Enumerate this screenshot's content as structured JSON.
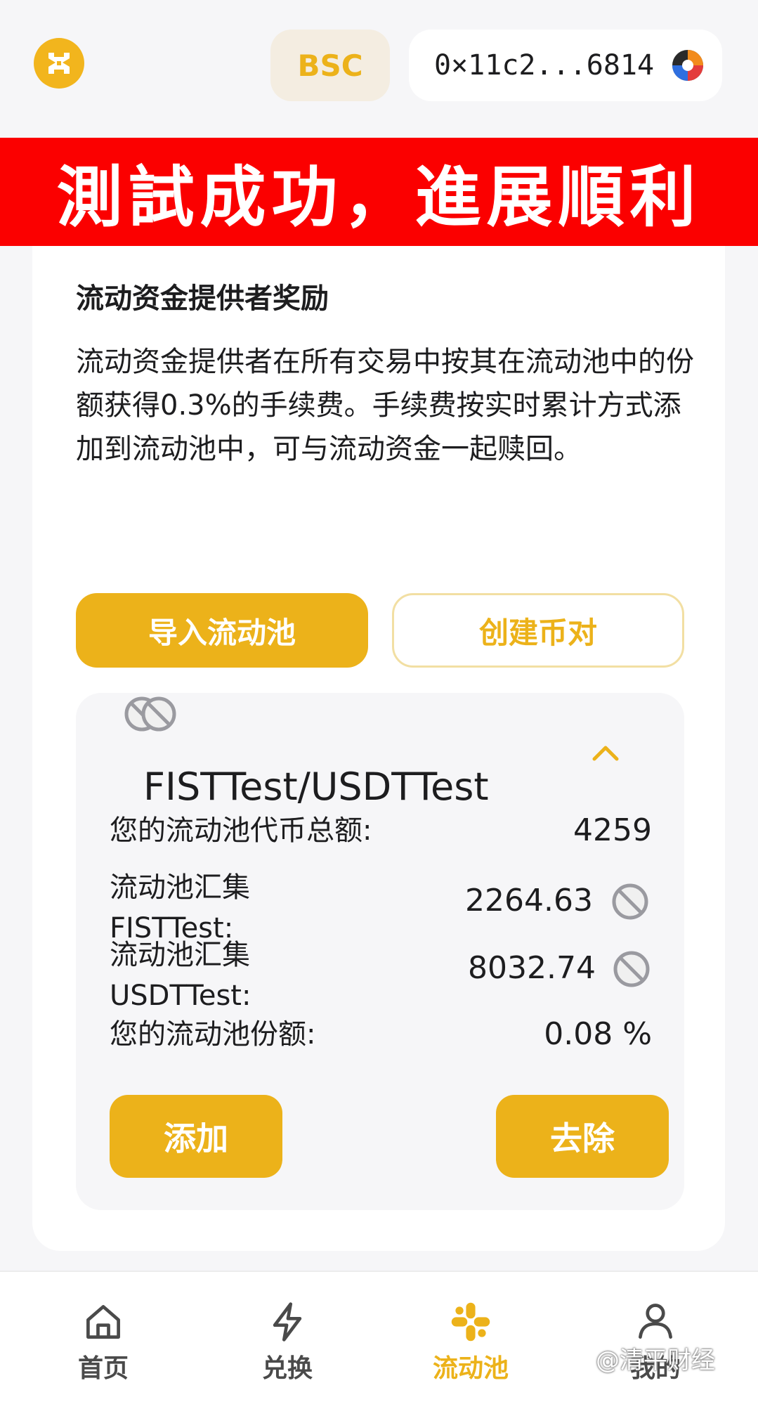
{
  "header": {
    "logo_icon": "app-logo-icon",
    "chain": "BSC",
    "wallet_address": "0×11c2...6814",
    "wallet_avatar_icon": "wallet-avatar-icon"
  },
  "banner": {
    "text": "測試成功，進展順利",
    "background": "#fb0000"
  },
  "info": {
    "title": "流动资金提供者奖励",
    "description": "流动资金提供者在所有交易中按其在流动池中的份额获得0.3%的手续费。手续费按实时累计方式添加到流动池中，可与流动资金一起赎回。"
  },
  "actions": {
    "import_label": "导入流动池",
    "create_label": "创建币对"
  },
  "pool": {
    "pair_name": "FISTTest/USDTTest",
    "rows": [
      {
        "label": "您的流动池代币总额:",
        "value": "4259"
      },
      {
        "label": "流动池汇集\nFISTTest:",
        "value": "2264.63"
      },
      {
        "label": "流动池汇集\nUSDTTest:",
        "value": "8032.74"
      },
      {
        "label": "您的流动池份额:",
        "value": "0.08 %"
      }
    ],
    "add_label": "添加",
    "remove_label": "去除"
  },
  "nav": {
    "items": [
      {
        "label": "首页",
        "icon": "home-icon"
      },
      {
        "label": "兑换",
        "icon": "lightning-icon"
      },
      {
        "label": "流动池",
        "icon": "pool-icon",
        "active": true
      },
      {
        "label": "我的",
        "icon": "user-icon"
      }
    ]
  },
  "watermark": "@清平财经",
  "colors": {
    "accent": "#ecb21a",
    "banner": "#fb0000",
    "panel": "#f6f6f8"
  }
}
